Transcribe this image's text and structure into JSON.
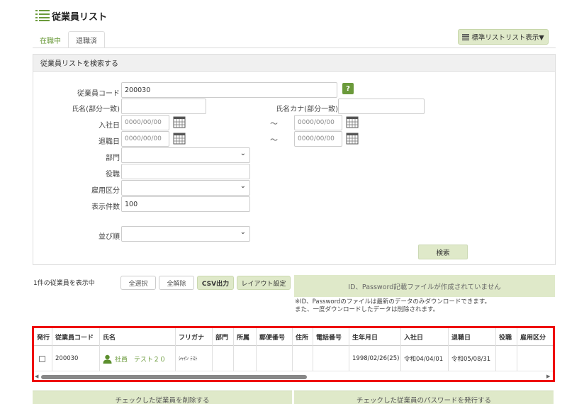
{
  "header": {
    "title": "従業員リスト",
    "icon": "list-icon"
  },
  "tabs": [
    {
      "label": "在職中"
    },
    {
      "label": "退職済"
    }
  ],
  "view_button": {
    "label": "標準リストリスト表示▼",
    "icon": "list-icon"
  },
  "search": {
    "heading": "従業員リストを検索する",
    "employee_code": {
      "label": "従業員コード",
      "value": "200030"
    },
    "help_label": "?",
    "name": {
      "label": "氏名(部分一致)",
      "value": ""
    },
    "kana": {
      "label": "氏名カナ(部分一致)",
      "value": ""
    },
    "hire_date": {
      "label": "入社日",
      "from_placeholder": "0000/00/00",
      "to_placeholder": "0000/00/00"
    },
    "retire_date": {
      "label": "退職日",
      "from_placeholder": "0000/00/00",
      "to_placeholder": "0000/00/00"
    },
    "range_separator": "～",
    "department": {
      "label": "部門",
      "value": ""
    },
    "position": {
      "label": "役職",
      "value": ""
    },
    "employment_type": {
      "label": "雇用区分",
      "value": ""
    },
    "display_count": {
      "label": "表示件数",
      "value": "100"
    },
    "sort_order": {
      "label": "並び順",
      "value": ""
    },
    "search_button": "検索"
  },
  "results": {
    "count_text": "1件の従業員を表示中",
    "select_all": "全選択",
    "deselect_all": "全解除",
    "csv_output": "CSV出力",
    "layout_settings": "レイアウト設定",
    "id_banner": "ID、Password記載ファイルが作成されていません",
    "note_line1": "※ID、Passwordのファイルは最新のデータのみダウンロードできます。",
    "note_line2": "また、一度ダウンロードしたデータは削除されます。"
  },
  "table": {
    "columns": [
      "発行",
      "従業員コード",
      "氏名",
      "フリガナ",
      "部門",
      "所属",
      "郵便番号",
      "住所",
      "電話番号",
      "生年月日",
      "入社日",
      "退職日",
      "役職",
      "雇用区分"
    ],
    "rows": [
      {
        "code": "200030",
        "name": "社員　テスト２０",
        "furigana": "ｼｬｲﾝ ﾃｽﾄ",
        "department": "",
        "affiliation": "",
        "postal": "",
        "address": "",
        "phone": "",
        "birthdate": "1998/02/26(25)",
        "hire_date": "令和04/04/01",
        "retire_date": "令和05/08/31",
        "position": "",
        "employment_type": ""
      }
    ]
  },
  "bottom": {
    "delete_checked": "チェックした従業員を削除する",
    "issue_password": "チェックした従業員のパスワードを発行する"
  },
  "colors": {
    "accent": "#6b9a3b",
    "button_bg": "#dfe9c9",
    "highlight": "#e00000"
  }
}
